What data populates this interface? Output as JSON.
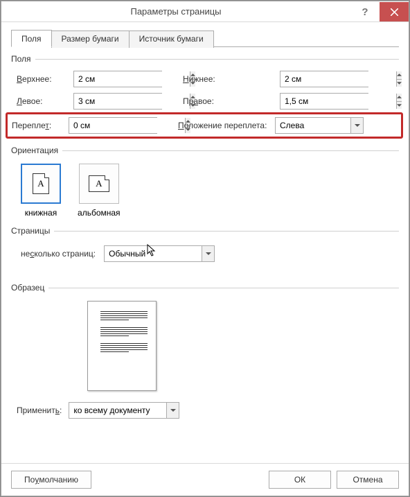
{
  "window": {
    "title": "Параметры страницы"
  },
  "tabs": {
    "margins": "Поля",
    "paperSize": "Размер бумаги",
    "paperSource": "Источник бумаги"
  },
  "groups": {
    "margins": "Поля",
    "orientation": "Ориентация",
    "pages": "Страницы",
    "preview": "Образец"
  },
  "margins": {
    "topLabel": "Верхнее:",
    "topValue": "2 см",
    "bottomLabel": "Нижнее:",
    "bottomValue": "2 см",
    "leftLabel": "Левое:",
    "leftValue": "3 см",
    "rightLabel": "Правое:",
    "rightValue": "1,5 см",
    "gutterLabel": "Переплет:",
    "gutterValue": "0 см",
    "gutterPosLabel": "Положение переплета:",
    "gutterPosValue": "Слева"
  },
  "orientation": {
    "portrait": "книжная",
    "landscape": "альбомная",
    "letter": "A"
  },
  "pages": {
    "multiLabel": "несколько страниц:",
    "multiValue": "Обычный"
  },
  "apply": {
    "label": "Применить:",
    "value": "ко всему документу"
  },
  "footer": {
    "default": "По умолчанию",
    "ok": "ОК",
    "cancel": "Отмена"
  }
}
